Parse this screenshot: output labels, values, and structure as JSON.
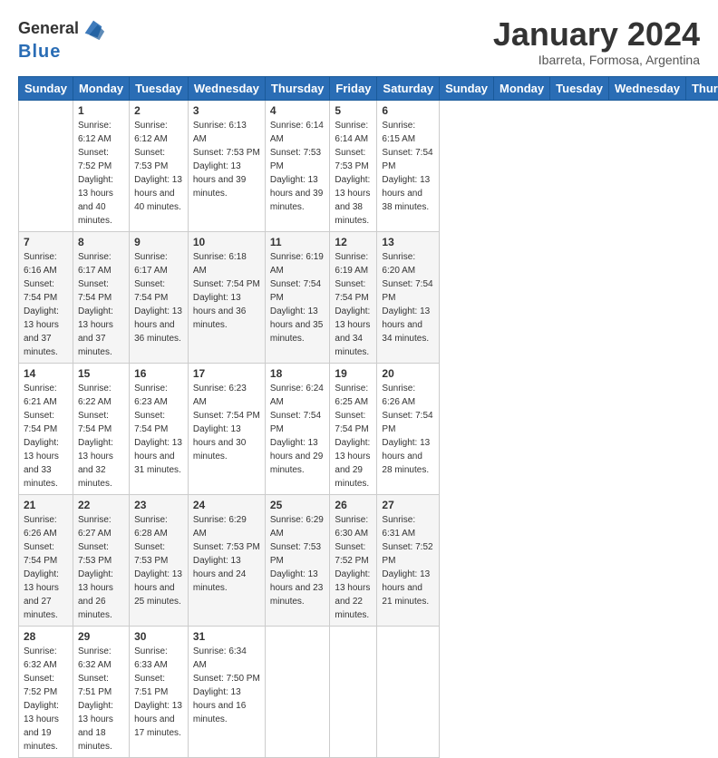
{
  "header": {
    "logo_line1": "General",
    "logo_line2": "Blue",
    "title": "January 2024",
    "subtitle": "Ibarreta, Formosa, Argentina"
  },
  "days": [
    "Sunday",
    "Monday",
    "Tuesday",
    "Wednesday",
    "Thursday",
    "Friday",
    "Saturday"
  ],
  "weeks": [
    [
      {
        "date": "",
        "sunrise": "",
        "sunset": "",
        "daylight": ""
      },
      {
        "date": "1",
        "sunrise": "Sunrise: 6:12 AM",
        "sunset": "Sunset: 7:52 PM",
        "daylight": "Daylight: 13 hours and 40 minutes."
      },
      {
        "date": "2",
        "sunrise": "Sunrise: 6:12 AM",
        "sunset": "Sunset: 7:53 PM",
        "daylight": "Daylight: 13 hours and 40 minutes."
      },
      {
        "date": "3",
        "sunrise": "Sunrise: 6:13 AM",
        "sunset": "Sunset: 7:53 PM",
        "daylight": "Daylight: 13 hours and 39 minutes."
      },
      {
        "date": "4",
        "sunrise": "Sunrise: 6:14 AM",
        "sunset": "Sunset: 7:53 PM",
        "daylight": "Daylight: 13 hours and 39 minutes."
      },
      {
        "date": "5",
        "sunrise": "Sunrise: 6:14 AM",
        "sunset": "Sunset: 7:53 PM",
        "daylight": "Daylight: 13 hours and 38 minutes."
      },
      {
        "date": "6",
        "sunrise": "Sunrise: 6:15 AM",
        "sunset": "Sunset: 7:54 PM",
        "daylight": "Daylight: 13 hours and 38 minutes."
      }
    ],
    [
      {
        "date": "7",
        "sunrise": "Sunrise: 6:16 AM",
        "sunset": "Sunset: 7:54 PM",
        "daylight": "Daylight: 13 hours and 37 minutes."
      },
      {
        "date": "8",
        "sunrise": "Sunrise: 6:17 AM",
        "sunset": "Sunset: 7:54 PM",
        "daylight": "Daylight: 13 hours and 37 minutes."
      },
      {
        "date": "9",
        "sunrise": "Sunrise: 6:17 AM",
        "sunset": "Sunset: 7:54 PM",
        "daylight": "Daylight: 13 hours and 36 minutes."
      },
      {
        "date": "10",
        "sunrise": "Sunrise: 6:18 AM",
        "sunset": "Sunset: 7:54 PM",
        "daylight": "Daylight: 13 hours and 36 minutes."
      },
      {
        "date": "11",
        "sunrise": "Sunrise: 6:19 AM",
        "sunset": "Sunset: 7:54 PM",
        "daylight": "Daylight: 13 hours and 35 minutes."
      },
      {
        "date": "12",
        "sunrise": "Sunrise: 6:19 AM",
        "sunset": "Sunset: 7:54 PM",
        "daylight": "Daylight: 13 hours and 34 minutes."
      },
      {
        "date": "13",
        "sunrise": "Sunrise: 6:20 AM",
        "sunset": "Sunset: 7:54 PM",
        "daylight": "Daylight: 13 hours and 34 minutes."
      }
    ],
    [
      {
        "date": "14",
        "sunrise": "Sunrise: 6:21 AM",
        "sunset": "Sunset: 7:54 PM",
        "daylight": "Daylight: 13 hours and 33 minutes."
      },
      {
        "date": "15",
        "sunrise": "Sunrise: 6:22 AM",
        "sunset": "Sunset: 7:54 PM",
        "daylight": "Daylight: 13 hours and 32 minutes."
      },
      {
        "date": "16",
        "sunrise": "Sunrise: 6:23 AM",
        "sunset": "Sunset: 7:54 PM",
        "daylight": "Daylight: 13 hours and 31 minutes."
      },
      {
        "date": "17",
        "sunrise": "Sunrise: 6:23 AM",
        "sunset": "Sunset: 7:54 PM",
        "daylight": "Daylight: 13 hours and 30 minutes."
      },
      {
        "date": "18",
        "sunrise": "Sunrise: 6:24 AM",
        "sunset": "Sunset: 7:54 PM",
        "daylight": "Daylight: 13 hours and 29 minutes."
      },
      {
        "date": "19",
        "sunrise": "Sunrise: 6:25 AM",
        "sunset": "Sunset: 7:54 PM",
        "daylight": "Daylight: 13 hours and 29 minutes."
      },
      {
        "date": "20",
        "sunrise": "Sunrise: 6:26 AM",
        "sunset": "Sunset: 7:54 PM",
        "daylight": "Daylight: 13 hours and 28 minutes."
      }
    ],
    [
      {
        "date": "21",
        "sunrise": "Sunrise: 6:26 AM",
        "sunset": "Sunset: 7:54 PM",
        "daylight": "Daylight: 13 hours and 27 minutes."
      },
      {
        "date": "22",
        "sunrise": "Sunrise: 6:27 AM",
        "sunset": "Sunset: 7:53 PM",
        "daylight": "Daylight: 13 hours and 26 minutes."
      },
      {
        "date": "23",
        "sunrise": "Sunrise: 6:28 AM",
        "sunset": "Sunset: 7:53 PM",
        "daylight": "Daylight: 13 hours and 25 minutes."
      },
      {
        "date": "24",
        "sunrise": "Sunrise: 6:29 AM",
        "sunset": "Sunset: 7:53 PM",
        "daylight": "Daylight: 13 hours and 24 minutes."
      },
      {
        "date": "25",
        "sunrise": "Sunrise: 6:29 AM",
        "sunset": "Sunset: 7:53 PM",
        "daylight": "Daylight: 13 hours and 23 minutes."
      },
      {
        "date": "26",
        "sunrise": "Sunrise: 6:30 AM",
        "sunset": "Sunset: 7:52 PM",
        "daylight": "Daylight: 13 hours and 22 minutes."
      },
      {
        "date": "27",
        "sunrise": "Sunrise: 6:31 AM",
        "sunset": "Sunset: 7:52 PM",
        "daylight": "Daylight: 13 hours and 21 minutes."
      }
    ],
    [
      {
        "date": "28",
        "sunrise": "Sunrise: 6:32 AM",
        "sunset": "Sunset: 7:52 PM",
        "daylight": "Daylight: 13 hours and 19 minutes."
      },
      {
        "date": "29",
        "sunrise": "Sunrise: 6:32 AM",
        "sunset": "Sunset: 7:51 PM",
        "daylight": "Daylight: 13 hours and 18 minutes."
      },
      {
        "date": "30",
        "sunrise": "Sunrise: 6:33 AM",
        "sunset": "Sunset: 7:51 PM",
        "daylight": "Daylight: 13 hours and 17 minutes."
      },
      {
        "date": "31",
        "sunrise": "Sunrise: 6:34 AM",
        "sunset": "Sunset: 7:50 PM",
        "daylight": "Daylight: 13 hours and 16 minutes."
      },
      {
        "date": "",
        "sunrise": "",
        "sunset": "",
        "daylight": ""
      },
      {
        "date": "",
        "sunrise": "",
        "sunset": "",
        "daylight": ""
      },
      {
        "date": "",
        "sunrise": "",
        "sunset": "",
        "daylight": ""
      }
    ]
  ]
}
